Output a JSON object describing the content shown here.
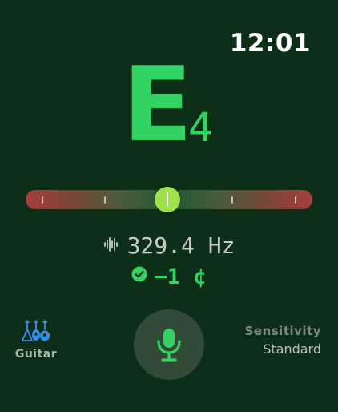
{
  "status": {
    "time": "12:01"
  },
  "tuner": {
    "note": "E",
    "octave": "4",
    "frequency": "329.4 Hz",
    "cents": "−1 ¢",
    "cents_value": -1,
    "in_tune": true
  },
  "instrument": {
    "label": "Guitar",
    "icon": "guitar-instruments-icon"
  },
  "mic": {
    "icon": "microphone-icon"
  },
  "sensitivity": {
    "title": "Sensitivity",
    "value": "Standard"
  },
  "colors": {
    "background": "#0d2f17",
    "accent_green": "#33d363",
    "indicator": "#9ee04a",
    "meter_edge_red": "#a53f3c",
    "instrument_blue": "#3a8ee6"
  }
}
